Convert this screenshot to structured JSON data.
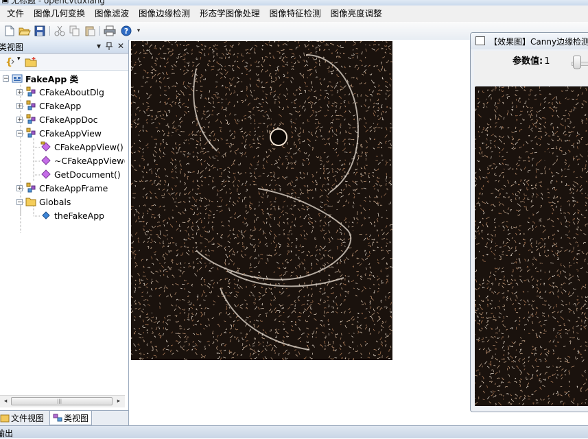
{
  "window": {
    "title": "无标题 - opencvtuxiang"
  },
  "menu": {
    "items": [
      "文件",
      "图像几何变换",
      "图像滤波",
      "图像边缘检测",
      "形态学图像处理",
      "图像特征检测",
      "图像亮度调整"
    ]
  },
  "toolbar": {
    "icons": [
      "new-icon",
      "open-icon",
      "save-icon",
      "cut-icon",
      "copy-icon",
      "paste-icon",
      "print-icon",
      "help-icon"
    ]
  },
  "class_view": {
    "title": "类视图",
    "pin_label": "ᵖ",
    "close_label": "✕",
    "tree": [
      {
        "label": "FakeApp 类",
        "level": 0,
        "expander": "−",
        "icon": "project-icon",
        "bold": true
      },
      {
        "label": "CFakeAboutDlg",
        "level": 1,
        "expander": "+",
        "icon": "class-icon"
      },
      {
        "label": "CFakeApp",
        "level": 1,
        "expander": "+",
        "icon": "class-icon"
      },
      {
        "label": "CFakeAppDoc",
        "level": 1,
        "expander": "+",
        "icon": "class-icon"
      },
      {
        "label": "CFakeAppView",
        "level": 1,
        "expander": "−",
        "icon": "class-icon"
      },
      {
        "label": "CFakeAppView()",
        "level": 2,
        "expander": "",
        "icon": "method-key-icon"
      },
      {
        "label": "~CFakeAppView()",
        "level": 2,
        "expander": "",
        "icon": "method-icon"
      },
      {
        "label": "GetDocument()",
        "level": 2,
        "expander": "",
        "icon": "method-icon"
      },
      {
        "label": "CFakeAppFrame",
        "level": 1,
        "expander": "+",
        "icon": "class-icon"
      },
      {
        "label": "Globals",
        "level": 1,
        "expander": "−",
        "icon": "folder-icon"
      },
      {
        "label": "theFakeApp",
        "level": 2,
        "expander": "",
        "icon": "variable-icon"
      }
    ],
    "tabs": [
      {
        "label": "文件视图",
        "active": false
      },
      {
        "label": "类视图",
        "active": true
      }
    ]
  },
  "effect_window": {
    "title": "【效果图】Canny边缘检测",
    "param_label": "参数值:",
    "param_value": "1"
  },
  "output": {
    "label": "输出"
  },
  "colors": {
    "accent": "#3d6fb6",
    "image_background": "#1a120d",
    "edge_color": "#e9d6c2"
  }
}
